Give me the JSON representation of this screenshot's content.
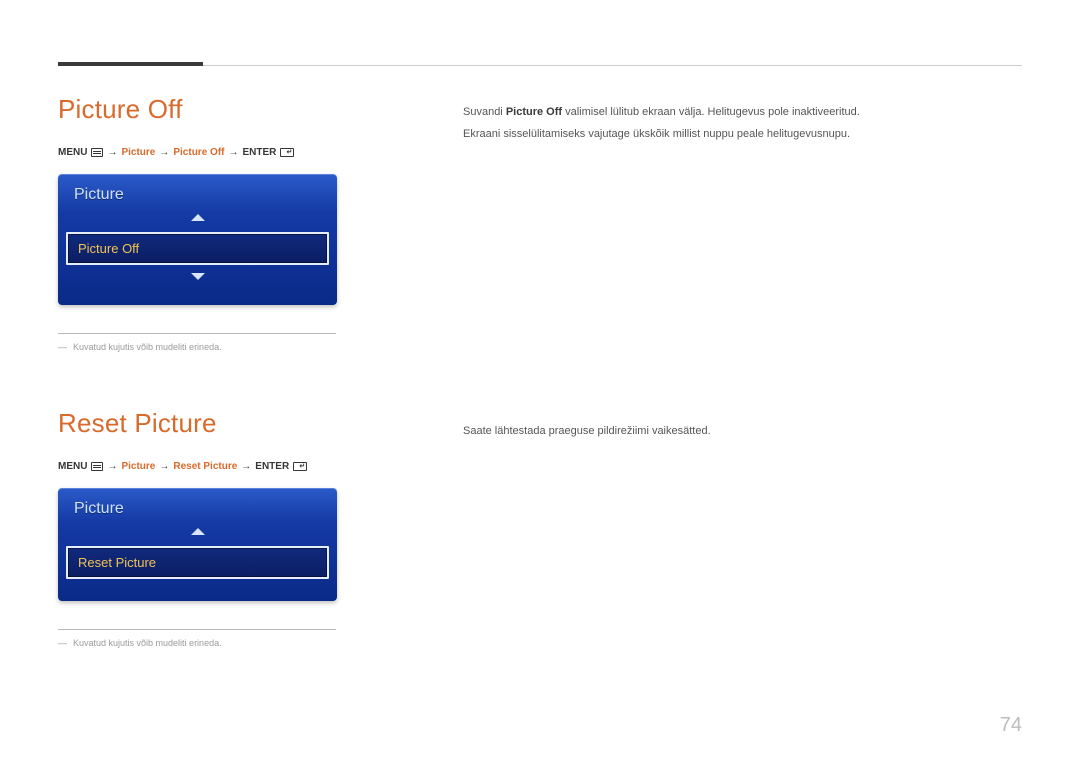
{
  "page_number": "74",
  "sections": [
    {
      "title": "Picture Off",
      "breadcrumb": {
        "menu": "MENU",
        "p1": "Picture",
        "p2": "Picture Off",
        "enter": "ENTER"
      },
      "osd": {
        "header": "Picture",
        "selected": "Picture Off",
        "show_down": true
      },
      "note": "Kuvatud kujutis võib mudeliti erineda.",
      "body": {
        "line1_pre": "Suvandi ",
        "line1_bold": "Picture Off",
        "line1_post": " valimisel lülitub ekraan välja. Helitugevus pole inaktiveeritud.",
        "line2": "Ekraani sisselülitamiseks vajutage ükskõik millist nuppu peale helitugevusnupu."
      }
    },
    {
      "title": "Reset Picture",
      "breadcrumb": {
        "menu": "MENU",
        "p1": "Picture",
        "p2": "Reset Picture",
        "enter": "ENTER"
      },
      "osd": {
        "header": "Picture",
        "selected": "Reset Picture",
        "show_down": false
      },
      "note": "Kuvatud kujutis võib mudeliti erineda.",
      "body": {
        "line1": "Saate lähtestada praeguse pildirežiimi vaikesätted."
      }
    }
  ]
}
